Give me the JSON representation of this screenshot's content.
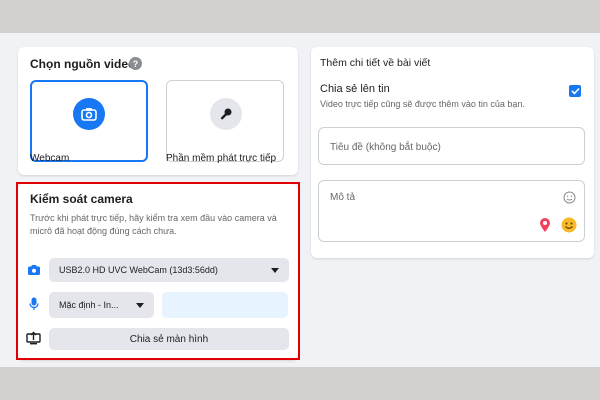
{
  "source": {
    "title": "Chọn nguồn video",
    "help_glyph": "?",
    "options": [
      {
        "label": "Webcam",
        "icon": "camera-icon",
        "selected": true
      },
      {
        "label": "Phần mềm phát trực tiếp",
        "icon": "key-icon",
        "selected": false
      }
    ]
  },
  "camera": {
    "title": "Kiểm soát camera",
    "description": "Trước khi phát trực tiếp, hãy kiểm tra xem đầu vào camera và micrô đã hoạt động đúng cách chưa.",
    "camera_select": "USB2.0 HD UVC WebCam (13d3:56dd)",
    "mic_select": "Mặc định - In...",
    "share_screen_label": "Chia sẻ màn hình"
  },
  "details": {
    "title": "Thêm chi tiết về bài viết",
    "share_story_label": "Chia sẻ lên tin",
    "share_story_desc": "Video trực tiếp cũng sẽ được thêm vào tin của bạn.",
    "share_story_checked": true,
    "title_placeholder": "Tiêu đề (không bắt buộc)",
    "description_placeholder": "Mô tả"
  },
  "colors": {
    "accent": "#1877f2",
    "highlight": "#e00000",
    "background": "#f0f2f5",
    "outer": "#d3d0cf"
  }
}
